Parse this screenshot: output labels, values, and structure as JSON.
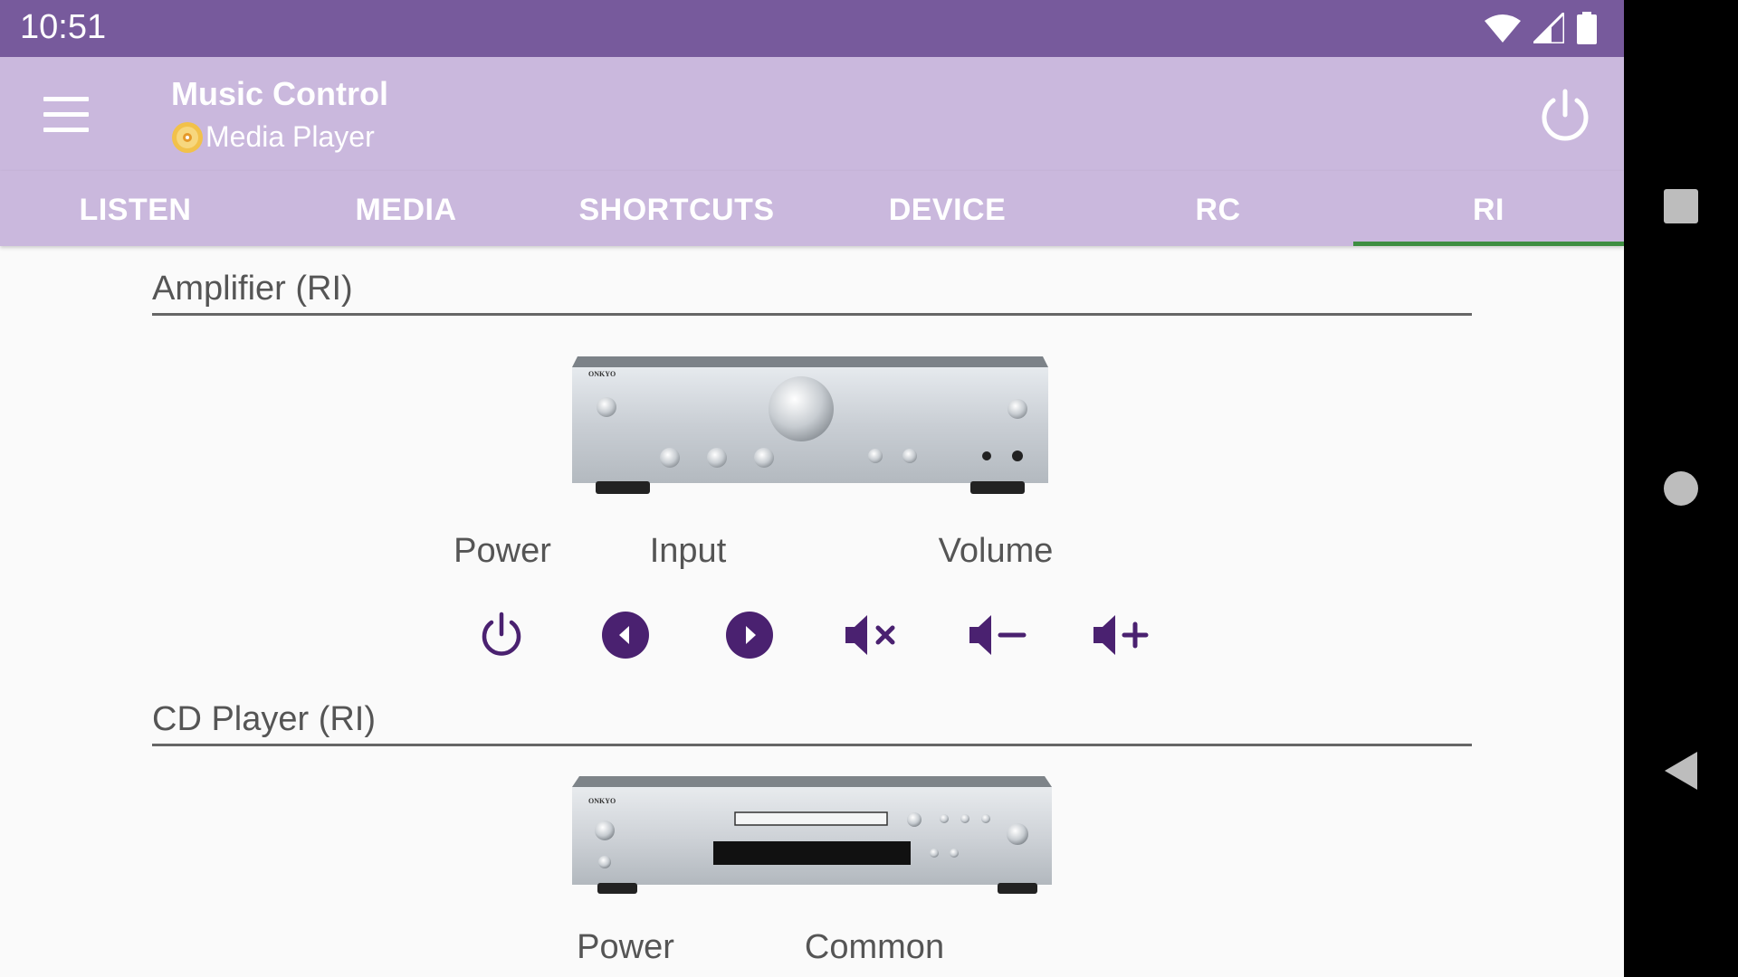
{
  "status_bar": {
    "time": "10:51"
  },
  "toolbar": {
    "title": "Music Control",
    "subtitle": "Media Player"
  },
  "tabs": [
    {
      "label": "LISTEN"
    },
    {
      "label": "MEDIA"
    },
    {
      "label": "SHORTCUTS"
    },
    {
      "label": "DEVICE"
    },
    {
      "label": "RC"
    },
    {
      "label": "RI",
      "active": true
    }
  ],
  "amplifier": {
    "title": "Amplifier (RI)",
    "labels": {
      "power": "Power",
      "input": "Input",
      "volume": "Volume"
    },
    "controls": [
      "power-icon",
      "input-prev-icon",
      "input-next-icon",
      "mute-icon",
      "volume-down-icon",
      "volume-up-icon"
    ],
    "device_brand": "ONKYO"
  },
  "cd_player": {
    "title": "CD Player (RI)",
    "labels": {
      "power": "Power",
      "common": "Common"
    },
    "device_brand": "ONKYO"
  },
  "colors": {
    "status_bar": "#775a9c",
    "toolbar": "#cab8dd",
    "accent_icon": "#4a2170",
    "tab_indicator": "#3e8e41"
  }
}
